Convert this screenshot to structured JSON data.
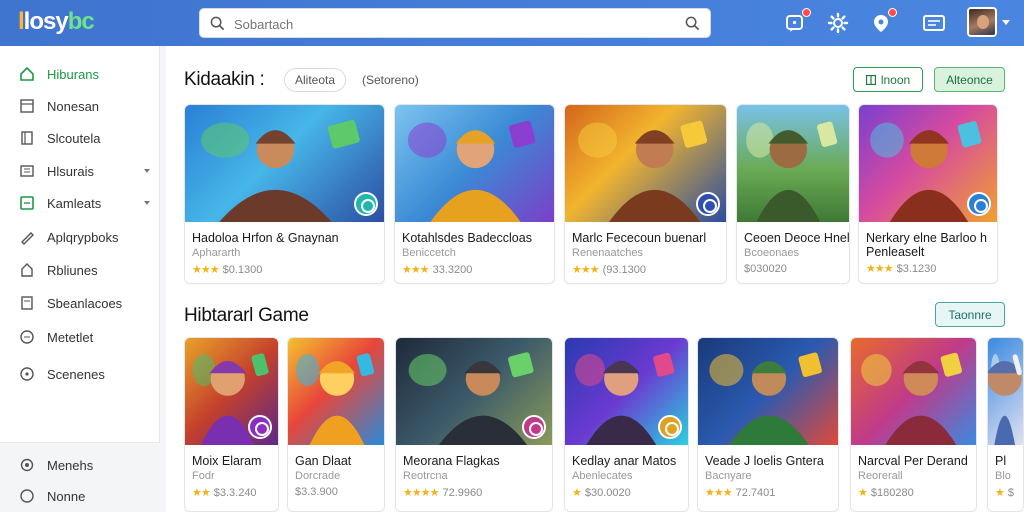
{
  "header": {
    "logo_part1": "l",
    "logo_part2": "losy",
    "logo_part3": "bc",
    "search_placeholder": "Sobartach",
    "icons": [
      "gamepad-icon",
      "settings-icon",
      "notifications-icon",
      "messages-icon"
    ]
  },
  "sidebar": {
    "items": [
      {
        "label": "Hiburans",
        "icon": "home-icon",
        "active": true
      },
      {
        "label": "Nonesan",
        "icon": "grid-icon"
      },
      {
        "label": "Slcoutela",
        "icon": "library-icon"
      },
      {
        "label": "Hlsurais",
        "icon": "store-icon",
        "caret": true
      },
      {
        "label": "Kamleats",
        "icon": "category-icon",
        "caret": true
      },
      {
        "label": "Aplqrypboks",
        "icon": "pen-icon"
      },
      {
        "label": "Rbliunes",
        "icon": "lock-icon"
      },
      {
        "label": "Sbeanlacoes",
        "icon": "file-icon"
      },
      {
        "label": "Metetlet",
        "icon": "chat-icon"
      },
      {
        "label": "Scenenes",
        "icon": "add-circle-icon"
      }
    ],
    "bottom": [
      {
        "label": "Menehs",
        "icon": "settings-icon"
      },
      {
        "label": "Nonne",
        "icon": "help-icon"
      }
    ]
  },
  "section1": {
    "title": "Kidaakin :",
    "chip1": "Aliteota",
    "chip2": "(Setoreno)",
    "btn1": "lnoon",
    "btn2": "Alteonce",
    "cards": [
      {
        "title": "Hadoloa Hrfon & Gnaynan",
        "sub": "Aphararth",
        "stars": 3,
        "rating": "$0.1300"
      },
      {
        "title": "Kotahlsdes Badeccloas",
        "sub": "Beniccetch",
        "stars": 3,
        "rating": "33.3200"
      },
      {
        "title": "Marlc Fececoun buenarl",
        "sub": "Renenaatches",
        "stars": 3,
        "rating": "(93.1300"
      },
      {
        "title": "Ceoen Deoce Hnele",
        "sub": "Bcoeonaes",
        "stars": 0,
        "rating": "$030020"
      },
      {
        "title": "Nerkary elne Barloo h",
        "title2": "Penleaselt",
        "sub": "",
        "stars": 3,
        "rating": "$3.1230"
      }
    ]
  },
  "section2": {
    "title": "Hibtararl Game",
    "btn": "Taonnre",
    "cards": [
      {
        "title": "Moix Elaram",
        "sub": "Fodr",
        "stars": 2,
        "rating": "$3.3.240"
      },
      {
        "title": "Gan Dlaat",
        "sub": "Dorcrade",
        "stars": 0,
        "rating": "$3.3.900"
      },
      {
        "title": "Meorana Flagkas",
        "sub": "Reotrcna",
        "stars": 4,
        "rating": "72.9960"
      },
      {
        "title": "Kedlay anar Matos",
        "sub": "Abenlecates",
        "stars": 1,
        "rating": "$30.0020"
      },
      {
        "title": "Veade J loelis Gntera",
        "sub": "Bacnyare",
        "stars": 3,
        "rating": "72.7401"
      },
      {
        "title": "Narcval Per Derand",
        "sub": "Reorerall",
        "stars": 1,
        "rating": "$180280"
      },
      {
        "title": "Pl",
        "sub": "Blo",
        "stars": 1,
        "rating": "$"
      }
    ]
  },
  "colors": {
    "topbar": "#4a86e0",
    "accent_green": "#1a9a45",
    "star": "#f3b319"
  }
}
